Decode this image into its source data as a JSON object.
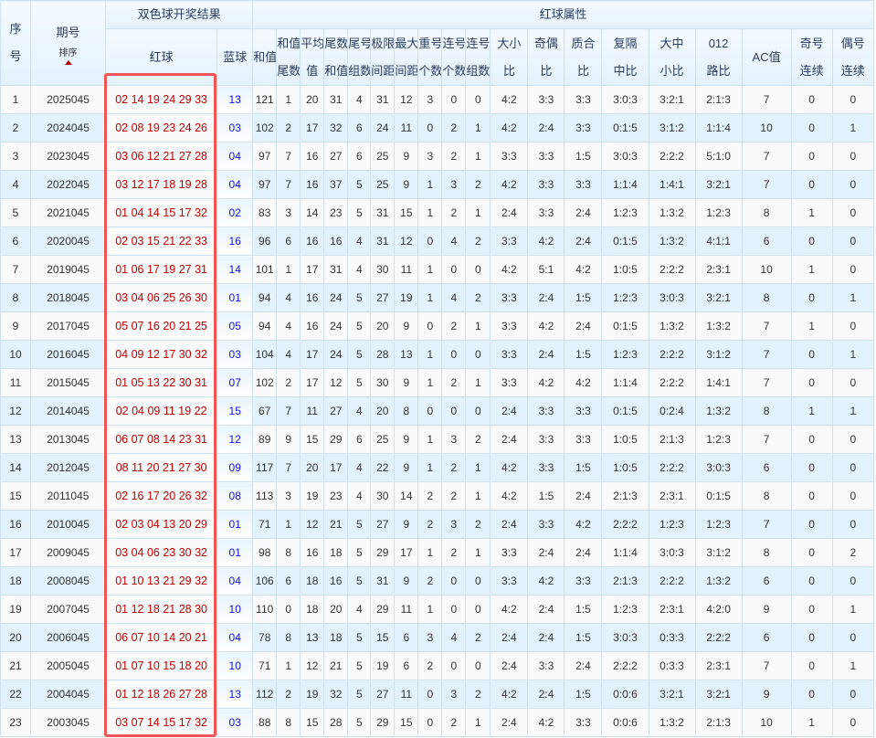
{
  "header": {
    "index": [
      "序",
      "号"
    ],
    "issue": "期号",
    "sort_label": "排序",
    "result_group": "双色球开奖结果",
    "red_ball": "红球",
    "blue_ball": "蓝球",
    "attr_group": "红球属性",
    "attr_cols": [
      [
        "和值"
      ],
      [
        "和值",
        "尾数"
      ],
      [
        "平均",
        "值"
      ],
      [
        "尾数",
        "和值"
      ],
      [
        "尾号",
        "组数"
      ],
      [
        "极限",
        "间距"
      ],
      [
        "最大",
        "间距"
      ],
      [
        "重号",
        "个数"
      ],
      [
        "连号",
        "个数"
      ],
      [
        "连号",
        "组数"
      ],
      [
        "大小",
        "比"
      ],
      [
        "奇偶",
        "比"
      ],
      [
        "质合",
        "比"
      ],
      [
        "复隔",
        "中比"
      ],
      [
        "大中",
        "小比"
      ],
      [
        "012",
        "路比"
      ],
      [
        "AC值"
      ],
      [
        "奇号",
        "连续"
      ],
      [
        "偶号",
        "连续"
      ]
    ]
  },
  "rows": [
    [
      "1",
      "2025045",
      "02 14 19 24 29 33",
      "13",
      "121",
      "1",
      "20",
      "31",
      "4",
      "31",
      "12",
      "3",
      "0",
      "0",
      "4:2",
      "3:3",
      "3:3",
      "3:0:3",
      "3:2:1",
      "2:1:3",
      "7",
      "0",
      "0"
    ],
    [
      "2",
      "2024045",
      "02 08 19 23 24 26",
      "03",
      "102",
      "2",
      "17",
      "32",
      "6",
      "24",
      "11",
      "0",
      "2",
      "1",
      "4:2",
      "2:4",
      "3:3",
      "0:1:5",
      "3:1:2",
      "1:1:4",
      "10",
      "0",
      "1"
    ],
    [
      "3",
      "2023045",
      "03 06 12 21 27 28",
      "04",
      "97",
      "7",
      "16",
      "27",
      "6",
      "25",
      "9",
      "3",
      "2",
      "1",
      "3:3",
      "3:3",
      "1:5",
      "3:0:3",
      "2:2:2",
      "5:1:0",
      "7",
      "0",
      "0"
    ],
    [
      "4",
      "2022045",
      "03 12 17 18 19 28",
      "04",
      "97",
      "7",
      "16",
      "37",
      "5",
      "25",
      "9",
      "1",
      "3",
      "2",
      "4:2",
      "3:3",
      "3:3",
      "1:1:4",
      "1:4:1",
      "3:2:1",
      "7",
      "0",
      "0"
    ],
    [
      "5",
      "2021045",
      "01 04 14 15 17 32",
      "02",
      "83",
      "3",
      "14",
      "23",
      "5",
      "31",
      "15",
      "1",
      "2",
      "1",
      "2:4",
      "3:3",
      "2:4",
      "1:2:3",
      "1:3:2",
      "1:2:3",
      "8",
      "1",
      "0"
    ],
    [
      "6",
      "2020045",
      "02 03 15 21 22 33",
      "16",
      "96",
      "6",
      "16",
      "16",
      "4",
      "31",
      "12",
      "0",
      "4",
      "2",
      "3:3",
      "4:2",
      "2:4",
      "0:1:5",
      "1:3:2",
      "4:1:1",
      "6",
      "0",
      "0"
    ],
    [
      "7",
      "2019045",
      "01 06 17 19 27 31",
      "14",
      "101",
      "1",
      "17",
      "31",
      "4",
      "30",
      "11",
      "1",
      "0",
      "0",
      "4:2",
      "5:1",
      "4:2",
      "1:0:5",
      "2:2:2",
      "2:3:1",
      "10",
      "1",
      "0"
    ],
    [
      "8",
      "2018045",
      "03 04 06 25 26 30",
      "01",
      "94",
      "4",
      "16",
      "24",
      "5",
      "27",
      "19",
      "1",
      "4",
      "2",
      "3:3",
      "2:4",
      "1:5",
      "1:2:3",
      "3:0:3",
      "3:2:1",
      "8",
      "0",
      "1"
    ],
    [
      "9",
      "2017045",
      "05 07 16 20 21 25",
      "05",
      "94",
      "4",
      "16",
      "24",
      "5",
      "20",
      "9",
      "0",
      "2",
      "1",
      "3:3",
      "4:2",
      "2:4",
      "0:1:5",
      "1:3:2",
      "1:3:2",
      "7",
      "1",
      "0"
    ],
    [
      "10",
      "2016045",
      "04 09 12 17 30 32",
      "03",
      "104",
      "4",
      "17",
      "24",
      "5",
      "28",
      "13",
      "1",
      "0",
      "0",
      "3:3",
      "2:4",
      "1:5",
      "1:2:3",
      "2:2:2",
      "3:1:2",
      "7",
      "0",
      "1"
    ],
    [
      "11",
      "2015045",
      "01 05 13 22 30 31",
      "07",
      "102",
      "2",
      "17",
      "12",
      "5",
      "30",
      "9",
      "1",
      "2",
      "1",
      "3:3",
      "4:2",
      "4:2",
      "1:1:4",
      "2:2:2",
      "1:4:1",
      "7",
      "0",
      "0"
    ],
    [
      "12",
      "2014045",
      "02 04 09 11 19 22",
      "15",
      "67",
      "7",
      "11",
      "27",
      "4",
      "20",
      "8",
      "0",
      "0",
      "0",
      "2:4",
      "3:3",
      "3:3",
      "0:1:5",
      "0:2:4",
      "1:3:2",
      "8",
      "1",
      "1"
    ],
    [
      "13",
      "2013045",
      "06 07 08 14 23 31",
      "12",
      "89",
      "9",
      "15",
      "29",
      "6",
      "25",
      "9",
      "1",
      "3",
      "2",
      "2:4",
      "3:3",
      "3:3",
      "1:0:5",
      "2:1:3",
      "1:2:3",
      "7",
      "0",
      "0"
    ],
    [
      "14",
      "2012045",
      "08 11 20 21 27 30",
      "09",
      "117",
      "7",
      "20",
      "17",
      "4",
      "22",
      "9",
      "1",
      "2",
      "1",
      "4:2",
      "3:3",
      "1:5",
      "1:0:5",
      "2:2:2",
      "3:0:3",
      "6",
      "0",
      "0"
    ],
    [
      "15",
      "2011045",
      "02 16 17 20 26 32",
      "08",
      "113",
      "3",
      "19",
      "23",
      "4",
      "30",
      "14",
      "2",
      "2",
      "1",
      "4:2",
      "1:5",
      "2:4",
      "2:1:3",
      "2:3:1",
      "0:1:5",
      "8",
      "0",
      "0"
    ],
    [
      "16",
      "2010045",
      "02 03 04 13 20 29",
      "01",
      "71",
      "1",
      "12",
      "21",
      "5",
      "27",
      "9",
      "2",
      "3",
      "2",
      "2:4",
      "3:3",
      "4:2",
      "2:2:2",
      "1:2:3",
      "1:2:3",
      "7",
      "0",
      "0"
    ],
    [
      "17",
      "2009045",
      "03 04 06 23 30 32",
      "01",
      "98",
      "8",
      "16",
      "18",
      "5",
      "29",
      "17",
      "1",
      "2",
      "1",
      "3:3",
      "2:4",
      "2:4",
      "1:1:4",
      "3:0:3",
      "3:1:2",
      "8",
      "0",
      "2"
    ],
    [
      "18",
      "2008045",
      "01 10 13 21 29 32",
      "04",
      "106",
      "6",
      "18",
      "16",
      "5",
      "31",
      "9",
      "2",
      "0",
      "0",
      "3:3",
      "4:2",
      "3:3",
      "2:1:3",
      "2:2:2",
      "1:3:2",
      "6",
      "0",
      "0"
    ],
    [
      "19",
      "2007045",
      "01 12 18 21 28 30",
      "10",
      "110",
      "0",
      "18",
      "20",
      "4",
      "29",
      "11",
      "1",
      "0",
      "0",
      "4:2",
      "2:4",
      "1:5",
      "1:2:3",
      "2:3:1",
      "4:2:0",
      "9",
      "0",
      "1"
    ],
    [
      "20",
      "2006045",
      "06 07 10 14 20 21",
      "04",
      "78",
      "8",
      "13",
      "18",
      "5",
      "15",
      "6",
      "3",
      "4",
      "2",
      "2:4",
      "2:4",
      "1:5",
      "3:0:3",
      "0:3:3",
      "2:2:2",
      "6",
      "0",
      "0"
    ],
    [
      "21",
      "2005045",
      "01 07 10 15 18 20",
      "10",
      "71",
      "1",
      "12",
      "21",
      "5",
      "19",
      "6",
      "2",
      "0",
      "0",
      "2:4",
      "3:3",
      "2:4",
      "2:2:2",
      "0:3:3",
      "2:3:1",
      "7",
      "0",
      "1"
    ],
    [
      "22",
      "2004045",
      "01 12 18 26 27 28",
      "13",
      "112",
      "2",
      "19",
      "32",
      "5",
      "27",
      "11",
      "0",
      "3",
      "2",
      "4:2",
      "2:4",
      "1:5",
      "0:0:6",
      "3:2:1",
      "3:2:1",
      "9",
      "0",
      "0"
    ],
    [
      "23",
      "2003045",
      "03 07 14 15 17 32",
      "03",
      "88",
      "8",
      "15",
      "28",
      "5",
      "29",
      "15",
      "0",
      "2",
      "1",
      "2:4",
      "4:2",
      "3:3",
      "0:0:6",
      "1:3:2",
      "2:1:3",
      "10",
      "1",
      "0"
    ]
  ],
  "colors": {
    "red_ball": "#c00000",
    "blue_ball": "#1010e0",
    "highlight_box": "#f25555",
    "stripe": "#e3f3fd"
  }
}
